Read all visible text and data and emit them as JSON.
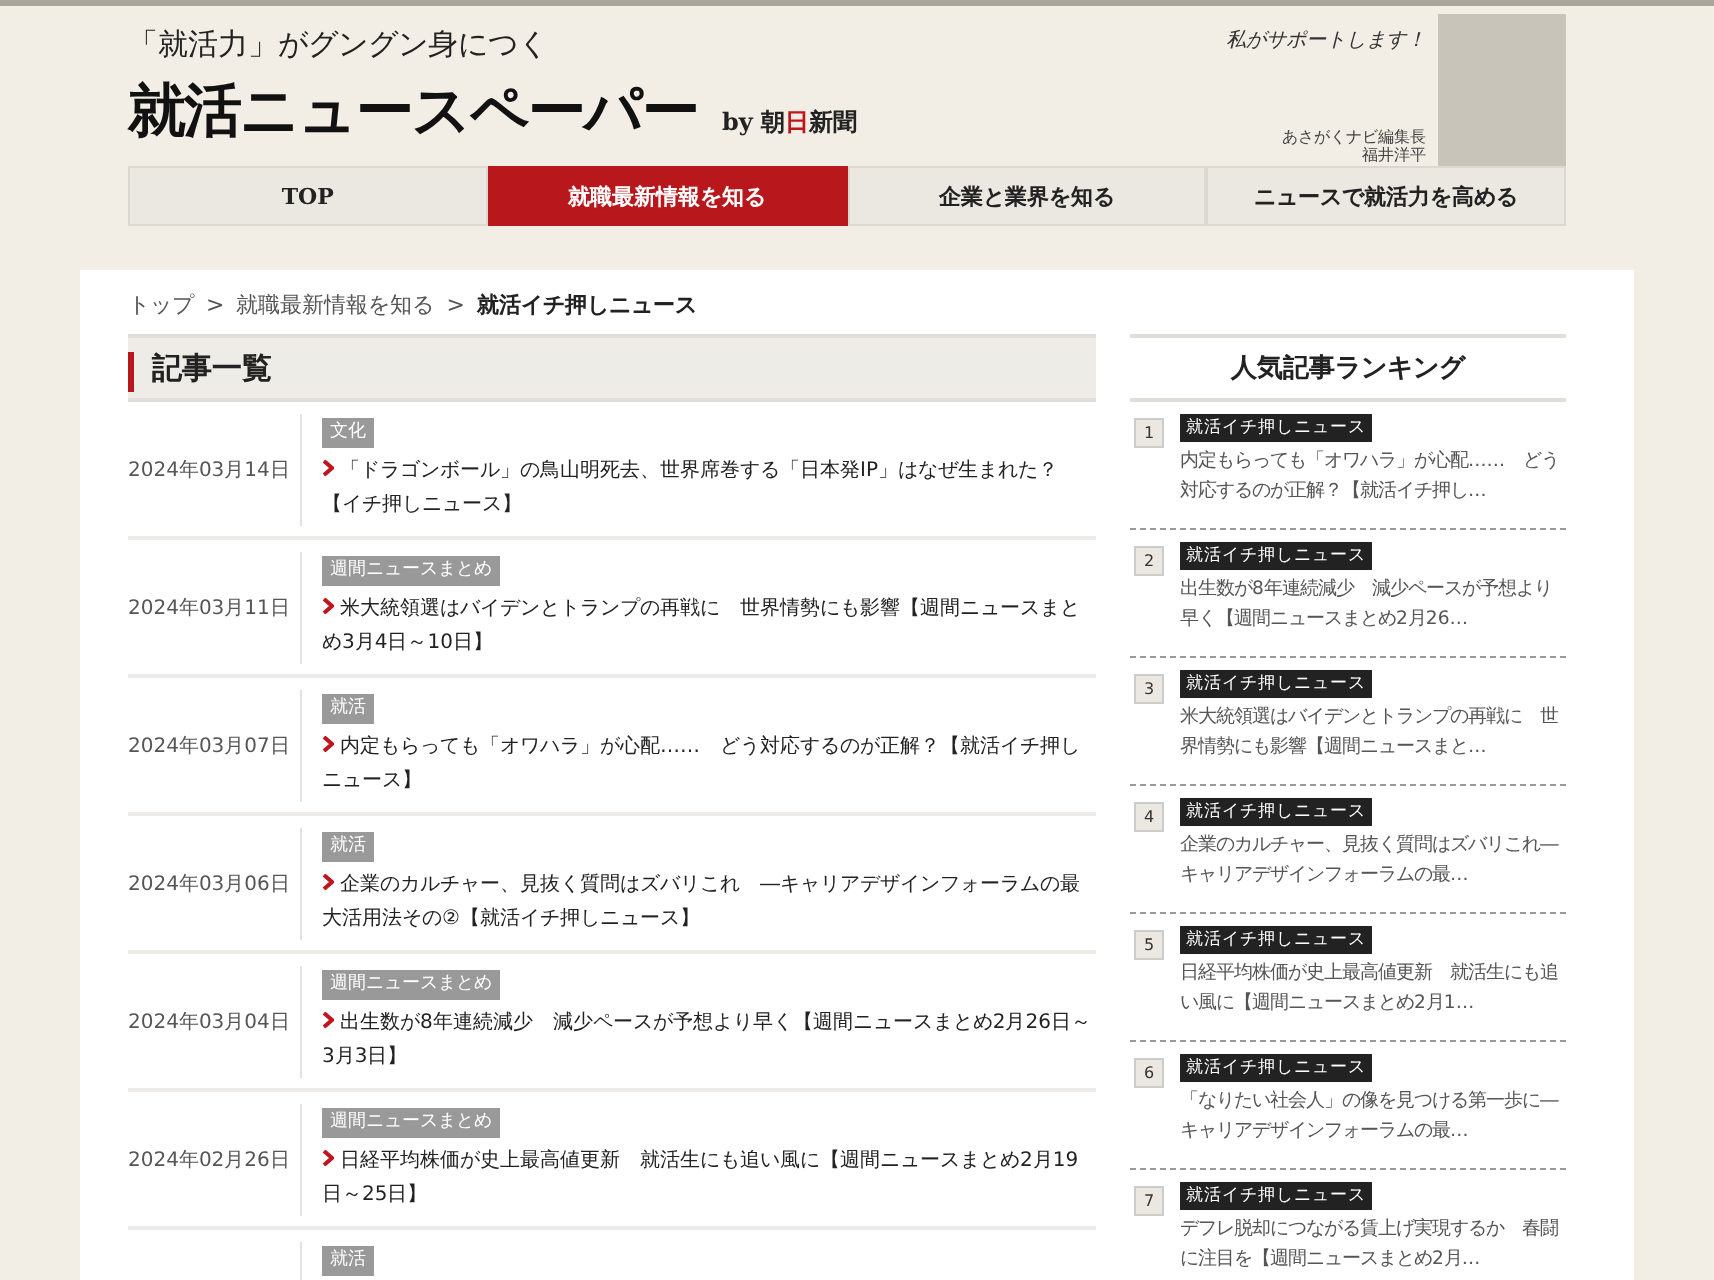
{
  "header": {
    "tagline": "「就活力」がグングン身につく",
    "title": "就活ニュースペーパー",
    "brand": {
      "before": "by 朝",
      "accent": "日",
      "after": "新聞"
    },
    "editor": {
      "speech": "私がサポートします！",
      "role": "あさがくナビ編集長",
      "name": "福井洋平"
    }
  },
  "nav": [
    {
      "label": "TOP",
      "selected": false
    },
    {
      "label": "就職最新情報を知る",
      "selected": true
    },
    {
      "label": "企業と業界を知る",
      "selected": false
    },
    {
      "label": "ニュースで就活力を高める",
      "selected": false
    }
  ],
  "breadcrumb": [
    "トップ",
    "就職最新情報を知る",
    "就活イチ押しニュース"
  ],
  "breadcrumb_separator": ">",
  "articles_heading": "記事一覧",
  "articles": [
    {
      "date": "2024年03月14日",
      "tag": "文化",
      "title": "「ドラゴンボール」の鳥山明死去、世界席巻する「日本発IP」はなぜ生まれた？【イチ押しニュース】"
    },
    {
      "date": "2024年03月11日",
      "tag": "週間ニュースまとめ",
      "title": "米大統領選はバイデンとトランプの再戦に　世界情勢にも影響【週間ニュースまとめ3月4日～10日】"
    },
    {
      "date": "2024年03月07日",
      "tag": "就活",
      "title": "内定もらっても「オワハラ」が心配……　どう対応するのが正解？【就活イチ押しニュース】"
    },
    {
      "date": "2024年03月06日",
      "tag": "就活",
      "title": "企業のカルチャー、見抜く質問はズバリこれ　―キャリアデザインフォーラムの最大活用法その②【就活イチ押しニュース】"
    },
    {
      "date": "2024年03月04日",
      "tag": "週間ニュースまとめ",
      "title": "出生数が8年連続減少　減少ペースが予想より早く【週間ニュースまとめ2月26日～3月3日】"
    },
    {
      "date": "2024年02月26日",
      "tag": "週間ニュースまとめ",
      "title": "日経平均株価が史上最高値更新　就活生にも追い風に【週間ニュースまとめ2月19日～25日】"
    },
    {
      "tag": "就活"
    }
  ],
  "ranking": {
    "title": "人気記事ランキング",
    "items": [
      {
        "rank": "1",
        "tag": "就活イチ押しニュース",
        "text": "内定もらっても「オワハラ」が心配……　どう対応するのが正解？【就活イチ押し…"
      },
      {
        "rank": "2",
        "tag": "就活イチ押しニュース",
        "text": "出生数が8年連続減少　減少ペースが予想より早く【週間ニュースまとめ2月26…"
      },
      {
        "rank": "3",
        "tag": "就活イチ押しニュース",
        "text": "米大統領選はバイデンとトランプの再戦に　世界情勢にも影響【週間ニュースまと…"
      },
      {
        "rank": "4",
        "tag": "就活イチ押しニュース",
        "text": "企業のカルチャー、見抜く質問はズバリこれ―キャリアデザインフォーラムの最…"
      },
      {
        "rank": "5",
        "tag": "就活イチ押しニュース",
        "text": "日経平均株価が史上最高値更新　就活生にも追い風に【週間ニュースまとめ2月1…"
      },
      {
        "rank": "6",
        "tag": "就活イチ押しニュース",
        "text": "「なりたい社会人」の像を見つける第一歩に―キャリアデザインフォーラムの最…"
      },
      {
        "rank": "7",
        "tag": "就活イチ押しニュース",
        "text": "デフレ脱却につながる賃上げ実現するか　春闘に注目を【週間ニュースまとめ2月…"
      }
    ]
  }
}
